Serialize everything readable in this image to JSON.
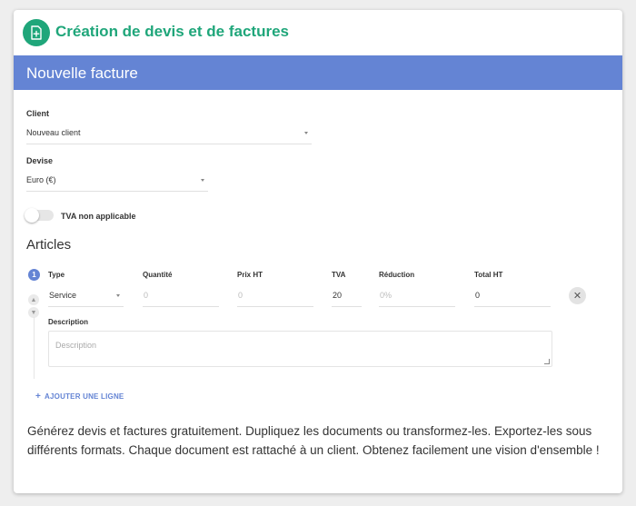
{
  "app": {
    "title": "Création de devis et de factures",
    "logo_icon": "document-plus-icon",
    "accent_color": "#1fa67a"
  },
  "banner": {
    "title": "Nouvelle facture",
    "color": "#6484d4"
  },
  "client": {
    "label": "Client",
    "selected": "Nouveau client"
  },
  "currency": {
    "label": "Devise",
    "selected": "Euro (€)"
  },
  "vat_toggle": {
    "label": "TVA non applicable",
    "on": false
  },
  "articles": {
    "title": "Articles",
    "columns": {
      "type": "Type",
      "quantity": "Quantité",
      "unit_price": "Prix HT",
      "vat": "TVA",
      "discount": "Réduction",
      "total": "Total HT"
    },
    "lines": [
      {
        "number": "1",
        "type": "Service",
        "quantity_placeholder": "0",
        "unit_price_placeholder": "0",
        "vat": "20",
        "discount_placeholder": "0%",
        "total": "0",
        "description_label": "Description",
        "description_placeholder": "Description"
      }
    ],
    "add_line_label": "AJOUTER UNE LIGNE"
  },
  "blurb": "Générez devis et factures gratuitement. Dupliquez les documents ou transformez-les. Exportez-les sous différents formats. Chaque document est rattaché à un client. Obtenez facilement une vision d'ensemble !"
}
